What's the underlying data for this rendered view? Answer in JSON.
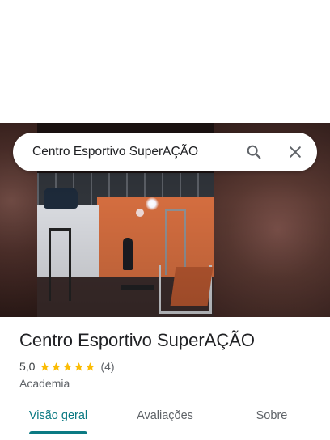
{
  "search": {
    "query": "Centro Esportivo SuperAÇÃO",
    "search_icon": "search-icon",
    "close_icon": "close-icon"
  },
  "place": {
    "name": "Centro Esportivo SuperAÇÃO",
    "rating": "5,0",
    "stars": 5,
    "review_count": "(4)",
    "category": "Academia"
  },
  "tabs": [
    {
      "label": "Visão geral",
      "active": true
    },
    {
      "label": "Avaliações",
      "active": false
    },
    {
      "label": "Sobre",
      "active": false
    }
  ],
  "colors": {
    "accent": "#0b7a83",
    "star": "#fbbc04",
    "text_secondary": "#5f6368"
  }
}
